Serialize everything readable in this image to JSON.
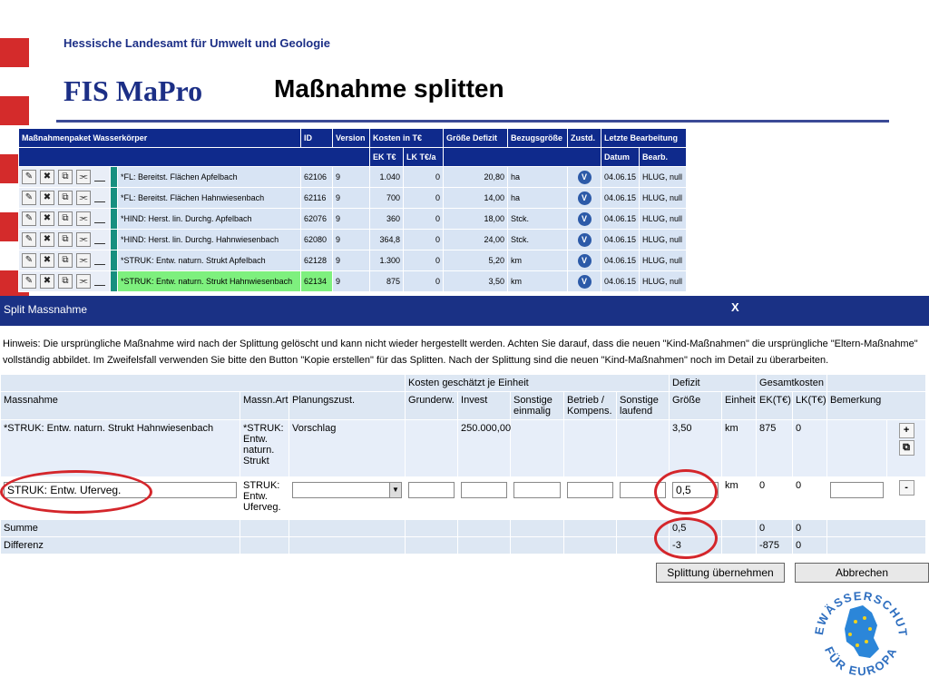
{
  "header": {
    "org": "Hessische Landesamt für Umwelt und Geologie",
    "app_title": "FIS MaPro",
    "slide_title": "Maßnahme splitten"
  },
  "package_table": {
    "columns": [
      "Maßnahmenpaket Wasserkörper",
      "ID",
      "Version",
      "Kosten in T€",
      "Größe Defizit",
      "Bezugsgröße",
      "Zustd.",
      "Letzte Bearbeitung"
    ],
    "subcolumns": [
      "EK T€",
      "LK T€/a",
      "Datum",
      "Bearb."
    ],
    "status_icon": "V",
    "rows": [
      {
        "name": "*FL: Bereitst. Flächen Apfelbach",
        "id": "62106",
        "version": "9",
        "ek": "1.040",
        "lk": "0",
        "size": "20,80",
        "unit": "ha",
        "date": "04.06.15",
        "user": "HLUG, null"
      },
      {
        "name": "*FL: Bereitst. Flächen Hahnwiesenbach",
        "id": "62116",
        "version": "9",
        "ek": "700",
        "lk": "0",
        "size": "14,00",
        "unit": "ha",
        "date": "04.06.15",
        "user": "HLUG, null"
      },
      {
        "name": "*HIND: Herst. lin. Durchg. Apfelbach",
        "id": "62076",
        "version": "9",
        "ek": "360",
        "lk": "0",
        "size": "18,00",
        "unit": "Stck.",
        "date": "04.06.15",
        "user": "HLUG, null"
      },
      {
        "name": "*HIND: Herst. lin. Durchg. Hahnwiesenbach",
        "id": "62080",
        "version": "9",
        "ek": "364,8",
        "lk": "0",
        "size": "24,00",
        "unit": "Stck.",
        "date": "04.06.15",
        "user": "HLUG, null"
      },
      {
        "name": "*STRUK: Entw. naturn. Strukt Apfelbach",
        "id": "62128",
        "version": "9",
        "ek": "1.300",
        "lk": "0",
        "size": "5,20",
        "unit": "km",
        "date": "04.06.15",
        "user": "HLUG, null"
      },
      {
        "name": "*STRUK: Entw. naturn. Strukt Hahnwiesenbach",
        "id": "62134",
        "version": "9",
        "ek": "875",
        "lk": "0",
        "size": "3,50",
        "unit": "km",
        "date": "04.06.15",
        "user": "HLUG, null"
      }
    ]
  },
  "dialog": {
    "title": "Split Massnahme",
    "close": "X",
    "hint": "Hinweis: Die ursprüngliche Maßnahme wird nach der Splittung gelöscht und kann nicht wieder hergestellt werden. Achten Sie darauf, dass die neuen \"Kind-Maßnahmen\" die ursprüngliche \"Eltern-Maßnahme\" vollständig abbildet. Im Zweifelsfall verwenden Sie bitte den Button \"Kopie erstellen\" für das Splitten. Nach der Splittung sind die neuen \"Kind-Maßnahmen\" noch im Detail zu überarbeiten.",
    "groups": {
      "costs": "Kosten geschätzt je Einheit",
      "deficit": "Defizit",
      "total": "Gesamtkosten"
    },
    "columns": {
      "massnahme": "Massnahme",
      "art": "Massn.Art",
      "planung": "Planungszust.",
      "grunderw": "Grunderw.",
      "invest": "Invest",
      "sonst_einmalig": "Sonstige einmalig",
      "betrieb": "Betrieb / Kompens.",
      "sonst_laufend": "Sonstige laufend",
      "groesse": "Größe",
      "einheit": "Einheit",
      "ek": "EK(T€)",
      "lk": "LK(T€)",
      "bemerkung": "Bemerkung"
    },
    "original": {
      "massnahme": "*STRUK: Entw. naturn. Strukt Hahnwiesenbach",
      "art": "*STRUK: Entw. naturn. Strukt",
      "planung": "Vorschlag",
      "invest": "250.000,00",
      "groesse": "3,50",
      "einheit": "km",
      "ek": "875",
      "lk": "0",
      "add_icon": "+",
      "copy_icon": "⧉"
    },
    "new_row": {
      "massnahme_value": "STRUK: Entw. Uferveg.",
      "art": "STRUK: Entw. Uferveg.",
      "groesse_value": "0,5",
      "einheit": "km",
      "ek": "0",
      "lk": "0",
      "remove_icon": "-"
    },
    "summe": {
      "label": "Summe",
      "groesse": "0,5",
      "ek": "0",
      "lk": "0"
    },
    "differenz": {
      "label": "Differenz",
      "groesse": "-3",
      "ek": "-875",
      "lk": "0"
    },
    "apply_button": "Splittung übernehmen",
    "cancel_button": "Abbrechen"
  },
  "logo": {
    "top_text": "GEWÄSSERSCHUTZ",
    "bottom_text": "FÜR EUROPA"
  },
  "colors": {
    "brand": "#1c2f86",
    "accent_red": "#d42b2b",
    "highlight_green": "#7ef07e",
    "teal": "#178f7f"
  }
}
